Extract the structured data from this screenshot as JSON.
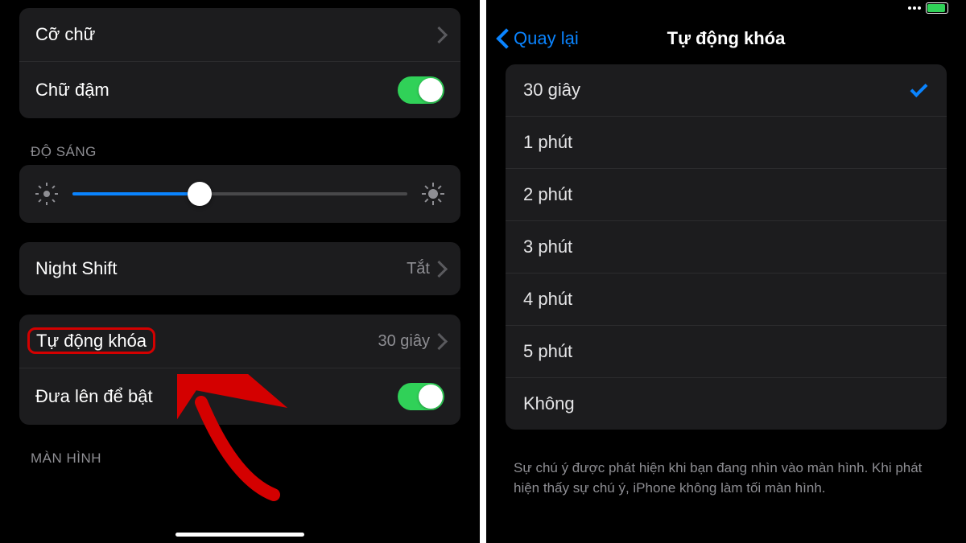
{
  "left": {
    "text_size_label": "Cỡ chữ",
    "bold_text_label": "Chữ đậm",
    "bold_text_on": true,
    "brightness_header": "ĐỘ SÁNG",
    "brightness_percent": 38,
    "night_shift_label": "Night Shift",
    "night_shift_value": "Tắt",
    "auto_lock_label": "Tự động khóa",
    "auto_lock_value": "30 giây",
    "raise_to_wake_label": "Đưa lên để bật",
    "raise_to_wake_on": true,
    "screen_header": "MÀN HÌNH"
  },
  "right": {
    "back_label": "Quay lại",
    "title": "Tự động khóa",
    "options": [
      {
        "label": "30 giây",
        "selected": true
      },
      {
        "label": "1 phút",
        "selected": false
      },
      {
        "label": "2 phút",
        "selected": false
      },
      {
        "label": "3 phút",
        "selected": false
      },
      {
        "label": "4 phút",
        "selected": false
      },
      {
        "label": "5 phút",
        "selected": false
      },
      {
        "label": "Không",
        "selected": false
      }
    ],
    "footer": "Sự chú ý được phát hiện khi bạn đang nhìn vào màn hình. Khi phát hiện thấy sự chú ý, iPhone không làm tối màn hình."
  }
}
